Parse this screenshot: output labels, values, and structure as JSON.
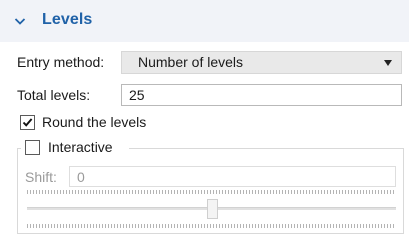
{
  "section": {
    "title": "Levels",
    "icon": "chevron-down-icon",
    "header_color": "#2062a8"
  },
  "entry_method": {
    "label": "Entry method:",
    "selected": "Number of levels"
  },
  "total_levels": {
    "label": "Total levels:",
    "value": "25"
  },
  "round_levels": {
    "label": "Round the levels",
    "checked": true
  },
  "interactive": {
    "label": "Interactive",
    "checked": false
  },
  "shift": {
    "label": "Shift:",
    "value": "0",
    "enabled": false,
    "slider_level": 0.5
  }
}
